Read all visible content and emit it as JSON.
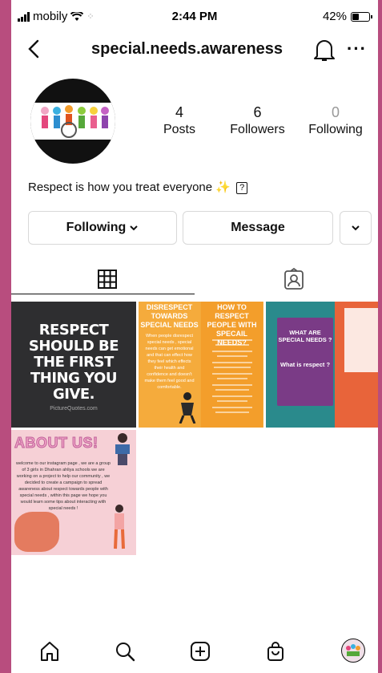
{
  "status_bar": {
    "carrier": "mobily",
    "time": "2:44 PM",
    "battery": "42%",
    "battery_level": 0.42
  },
  "header": {
    "username": "special.needs.awareness",
    "more": "···"
  },
  "profile": {
    "stats": [
      {
        "value": "4",
        "label": "Posts"
      },
      {
        "value": "6",
        "label": "Followers"
      },
      {
        "value": "0",
        "label": "Following"
      }
    ],
    "bio": "Respect is how you treat everyone",
    "bio_emoji": "✨"
  },
  "actions": {
    "following_label": "Following",
    "message_label": "Message"
  },
  "posts": {
    "post1": {
      "text": "RESPECT SHOULD BE THE FIRST THING YOU GIVE.",
      "credit": "PictureQuotes.com"
    },
    "post2": {
      "col1_title": "DISRESPECT TOWARDS SPECIAL NEEDS",
      "col1_text": "When people disrespect special needs , special needs can get emotional and that can effect how they feel which effects their health and confidence and doesn't make them feel good and comfortable.",
      "col2_title": "HOW TO RESPECT PEOPLE WITH SPECAIL NEEDS?"
    },
    "post3": {
      "title": "WHAT ARE SPECIAL NEEDS ?",
      "subtitle": "What is respect ?"
    },
    "post4": {
      "title": "ABOUT US!",
      "text": "welcome to our instagram page , we are a group of 3 girls in Dhahran ahliya schools we are working on a project to help our community , we decided to create a campaign to spread awareness about respect towards people with special needs , within this page we hope you would learn some tips about interacting with special needs !"
    }
  },
  "icons": {
    "back": "chevron-left-icon",
    "bell": "bell-icon",
    "grid": "grid-icon",
    "tagged": "tagged-icon",
    "home": "home-icon",
    "search": "search-icon",
    "new_post": "plus-square-icon",
    "shop": "shop-bag-icon"
  }
}
